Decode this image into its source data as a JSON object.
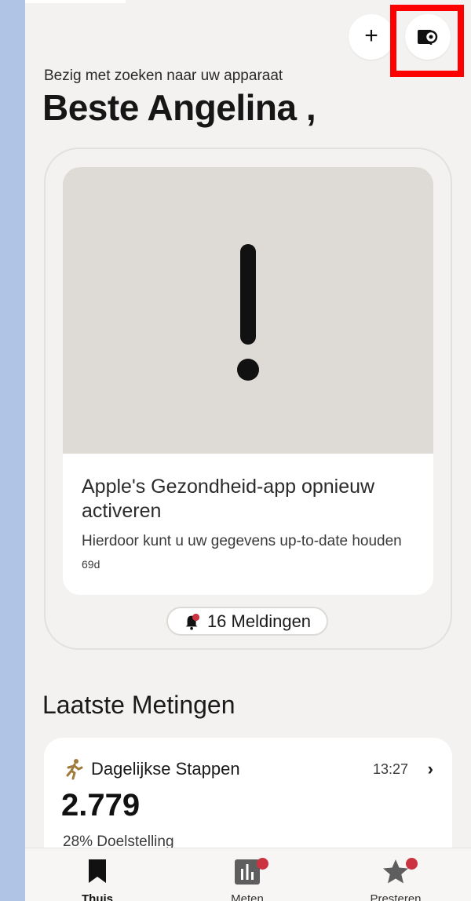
{
  "header": {
    "status_text": "Bezig met zoeken naar uw apparaat",
    "greeting": "Beste Angelina ,",
    "add_button_label": "+",
    "device_button_icon": "watch-search-icon"
  },
  "alert_card": {
    "icon": "exclamation-icon",
    "title": "Apple's Gezondheid-app opnieuw activeren",
    "description": "Hierdoor kunt u uw gegevens up-to-date houden",
    "age": "69d"
  },
  "notifications": {
    "icon": "bell-icon",
    "label": "16 Meldingen"
  },
  "measurements": {
    "section_title": "Laatste Metingen",
    "items": [
      {
        "icon": "walking-icon",
        "label": "Dagelijkse Stappen",
        "time": "13:27",
        "value": "2.779",
        "goal": "28% Doelstelling"
      }
    ]
  },
  "tabbar": {
    "tabs": [
      {
        "label": "Thuis",
        "icon": "bookmark-icon",
        "active": true,
        "badge": false
      },
      {
        "label": "Meten",
        "icon": "bar-chart-icon",
        "active": false,
        "badge": true
      },
      {
        "label": "Presteren",
        "icon": "star-icon",
        "active": false,
        "badge": true
      }
    ]
  },
  "colors": {
    "background": "#f3f2f1",
    "card": "#ffffff",
    "alert_area": "#dedbd6",
    "badge": "#cc3341",
    "highlight": "#ff0000",
    "walking_icon": "#a07a3a"
  }
}
